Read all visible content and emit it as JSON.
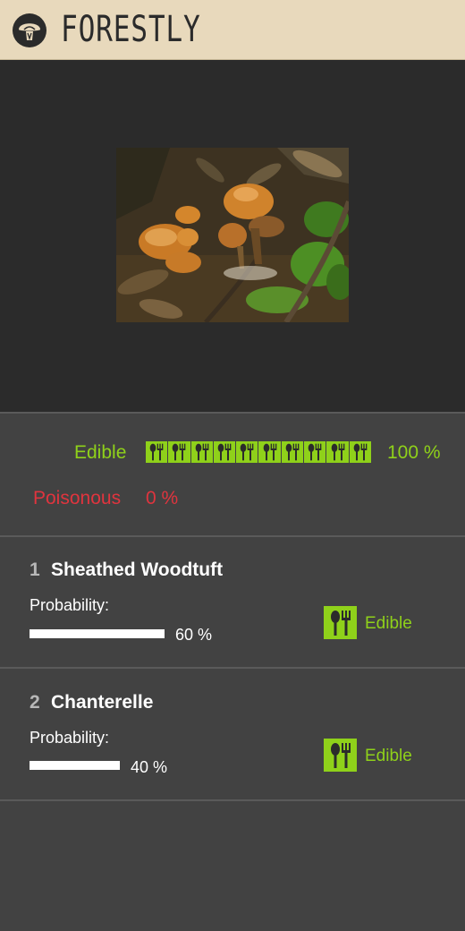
{
  "header": {
    "title": "FORESTLY",
    "logo_icon": "mushroom-logo-icon"
  },
  "photo": {
    "subject": "mushroom-photo"
  },
  "summary": {
    "edible_label": "Edible",
    "edible_percent": "100 %",
    "edible_fraction": 1.0,
    "poisonous_label": "Poisonous",
    "poisonous_percent": "0 %",
    "edible_icon": "cutlery-icon"
  },
  "results": [
    {
      "rank": "1",
      "name": "Sheathed Woodtuft",
      "probability_label": "Probability:",
      "probability_percent": "60 %",
      "probability": 0.6,
      "edibility": "Edible",
      "icon": "cutlery-icon"
    },
    {
      "rank": "2",
      "name": "Chanterelle",
      "probability_label": "Probability:",
      "probability_percent": "40 %",
      "probability": 0.4,
      "edibility": "Edible",
      "icon": "cutlery-icon"
    }
  ],
  "colors": {
    "header_bg": "#e8d9bc",
    "edible": "#8fd11a",
    "poisonous": "#e0343e",
    "panel_bg": "#424242",
    "photo_bg": "#2b2b2b"
  }
}
